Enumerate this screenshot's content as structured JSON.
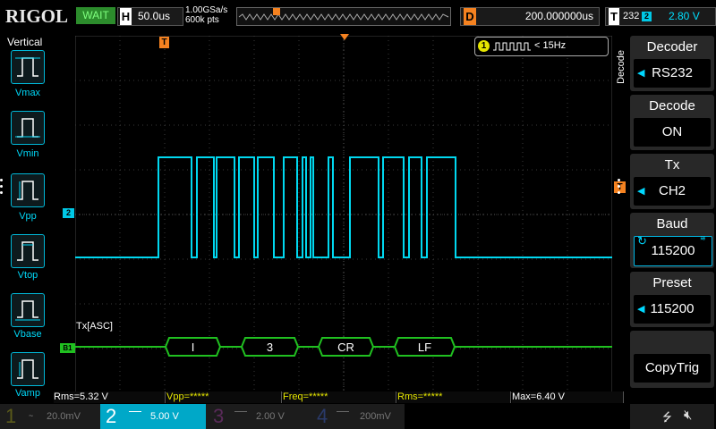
{
  "topbar": {
    "brand": "RIGOL",
    "run_status": "WAIT",
    "horizontal_key": "H",
    "horizontal_scale": "50.0us",
    "sample_rate": "1.00GSa/s",
    "memory_depth": "600k pts",
    "delay_key": "D",
    "delay_value": "200.000000us",
    "trigger_key": "T",
    "trigger_type": "232",
    "trigger_channel": "2",
    "trigger_level": "2.80 V"
  },
  "left_panel": {
    "title": "Vertical",
    "items": [
      {
        "label": "Vmax"
      },
      {
        "label": "Vmin"
      },
      {
        "label": "Vpp"
      },
      {
        "label": "Vtop"
      },
      {
        "label": "Vbase"
      },
      {
        "label": "Vamp"
      }
    ]
  },
  "right_panel": {
    "side_label": "Decode",
    "items": [
      {
        "title": "Decoder",
        "value": "RS232"
      },
      {
        "title": "Decode",
        "value": "ON"
      },
      {
        "title": "Tx",
        "value": "CH2"
      },
      {
        "title": "Baud",
        "value": "115200"
      },
      {
        "title": "Preset",
        "value": "115200"
      },
      {
        "title": "",
        "value": "CopyTrig"
      }
    ]
  },
  "waveform": {
    "freq_badge_channel": "1",
    "freq_badge_text": "< 15Hz",
    "channel2_marker": "2",
    "trigger_marker": "T",
    "decode_label": "Tx[ASC]",
    "bus_marker": "B1",
    "decoded_bytes": [
      "I",
      "3",
      "CR",
      "LF"
    ]
  },
  "measurements": [
    "Rms=5.32 V",
    "Vpp=*****",
    "Freq=*****",
    "Rms=*****",
    "Max=6.40 V"
  ],
  "channels": [
    {
      "num": "1",
      "scale": "20.0mV"
    },
    {
      "num": "2",
      "scale": "5.00 V"
    },
    {
      "num": "3",
      "scale": "2.00 V"
    },
    {
      "num": "4",
      "scale": "200mV"
    }
  ],
  "colors": {
    "ch1": "#e6e600",
    "ch2": "#00d8f0",
    "ch3": "#e040e0",
    "ch4": "#3060ff",
    "bus": "#20c020",
    "trigger": "#f58220"
  }
}
